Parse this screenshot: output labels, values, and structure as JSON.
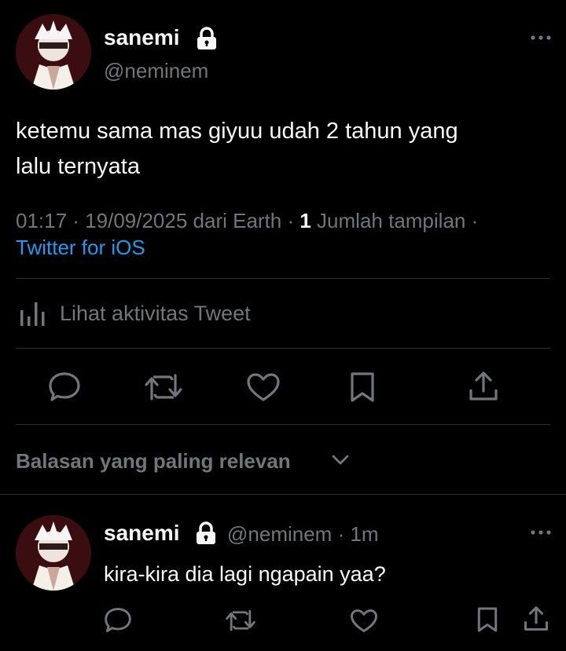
{
  "main_tweet": {
    "display_name": "sanemi",
    "handle": "@neminem",
    "text_line1": "ketemu sama mas giyuu udah 2 tahun yang",
    "text_line2": "lalu ternyata",
    "meta_time": "01:17 · 19/09/2025 dari Earth · ",
    "meta_views_count": "1",
    "meta_views_label": " Jumlah tampilan ·",
    "source": "Twitter for iOS",
    "activity_label": "Lihat aktivitas Tweet"
  },
  "replies_header": {
    "label": "Balasan yang paling relevan"
  },
  "reply": {
    "display_name": "sanemi",
    "handle": "@neminem",
    "time": "· 1m",
    "text": "kira-kira dia lagi ngapain yaa?"
  },
  "icons": {
    "lock": "lock-icon",
    "more": "more-icon",
    "reply": "reply-icon",
    "retweet": "retweet-icon",
    "like": "like-icon",
    "bookmark": "bookmark-icon",
    "share": "share-icon",
    "chevron": "chevron-down-icon",
    "stats": "stats-icon"
  },
  "colors": {
    "background": "#000000",
    "text": "#e7e9ea",
    "muted": "#71767b",
    "link": "#1d9bf0",
    "divider": "#2f3336"
  }
}
